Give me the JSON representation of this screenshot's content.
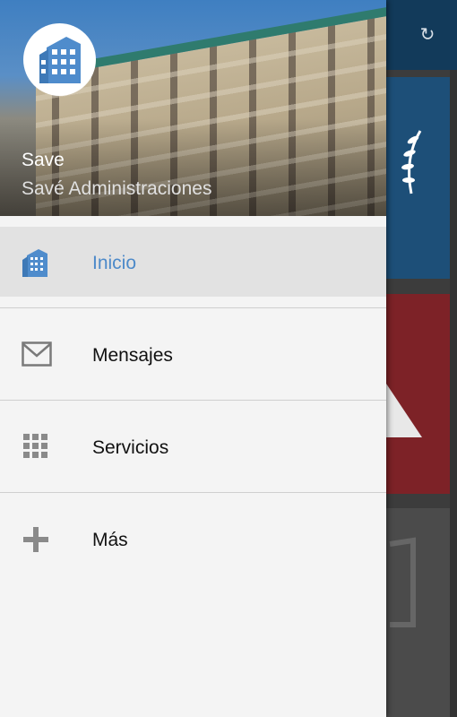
{
  "header": {
    "name": "Save",
    "subtitle": "Savé Administraciones"
  },
  "menu": {
    "items": [
      {
        "label": "Inicio",
        "icon": "building-icon",
        "active": true
      },
      {
        "label": "Mensajes",
        "icon": "envelope-icon",
        "active": false
      },
      {
        "label": "Servicios",
        "icon": "grid-icon",
        "active": false
      },
      {
        "label": "Más",
        "icon": "plus-icon",
        "active": false
      }
    ]
  },
  "background": {
    "refresh_glyph": "↻"
  },
  "colors": {
    "accent": "#4d8ac9",
    "active_row": "#e2e2e2",
    "drawer_bg": "#f4f4f4",
    "header_blue": "#3f7fc1"
  }
}
